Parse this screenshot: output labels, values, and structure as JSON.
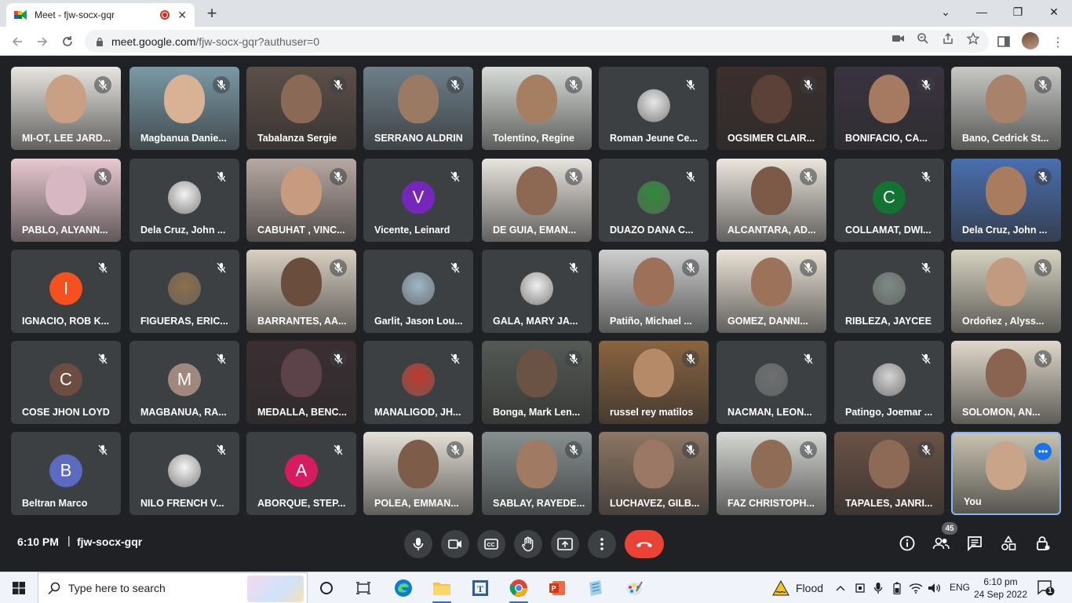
{
  "browser": {
    "tab_title": "Meet - fjw-socx-gqr",
    "tab_close": "✕",
    "new_tab": "+",
    "url_host": "meet.google.com",
    "url_path": "/fjw-socx-gqr?authuser=0",
    "window_controls": {
      "minimize": "—",
      "maximize": "❐",
      "close": "✕",
      "dropdown": "⌄"
    }
  },
  "participants": [
    {
      "name": "MI-OT, LEE JARD...",
      "kind": "video",
      "bg": "#e9e6e1",
      "skin": "#c9a083"
    },
    {
      "name": "Magbanua Danie...",
      "kind": "video",
      "bg": "#7a9aa6",
      "skin": "#d9b296"
    },
    {
      "name": "Tabalanza Sergie",
      "kind": "video",
      "bg": "#5d4f49",
      "skin": "#8a6a56"
    },
    {
      "name": "SERRANO ALDRIN",
      "kind": "video",
      "bg": "#6e7f8a",
      "skin": "#9b7a64"
    },
    {
      "name": "Tolentino, Regine",
      "kind": "video",
      "bg": "#d8dcd8",
      "skin": "#a67e62"
    },
    {
      "name": "Roman Jeune Ce...",
      "kind": "avatar",
      "avatar_color": "#e8e8e8"
    },
    {
      "name": "OGSIMER CLAIR...",
      "kind": "video",
      "bg": "#3b2f2d",
      "skin": "#5c4138"
    },
    {
      "name": "BONIFACIO, CA...",
      "kind": "video",
      "bg": "#3a3340",
      "skin": "#a67a61"
    },
    {
      "name": "Bano, Cedrick St...",
      "kind": "video",
      "bg": "#c8c8c4",
      "skin": "#a8826a"
    },
    {
      "name": "PABLO, ALYANN...",
      "kind": "video",
      "bg": "#e9c9d2",
      "skin": "#d7b7c2"
    },
    {
      "name": "Dela Cruz, John ...",
      "kind": "avatar",
      "avatar_color": "#f3f3f3"
    },
    {
      "name": "CABUHAT , VINC...",
      "kind": "video",
      "bg": "#b7a8a2",
      "skin": "#c79b7f"
    },
    {
      "name": "Vicente, Leinard",
      "kind": "initial",
      "letter": "V",
      "color": "#7627bb"
    },
    {
      "name": "DE GUIA, EMAN...",
      "kind": "video",
      "bg": "#e8e4de",
      "skin": "#8d6852"
    },
    {
      "name": "DUAZO DANA C...",
      "kind": "avatar",
      "avatar_color": "#2f8a3a"
    },
    {
      "name": "ALCANTARA, AD...",
      "kind": "video",
      "bg": "#ece6dd",
      "skin": "#7d5a47"
    },
    {
      "name": "COLLAMAT, DWI...",
      "kind": "initial",
      "letter": "C",
      "color": "#137333"
    },
    {
      "name": "Dela Cruz, John ...",
      "kind": "video",
      "bg": "#4a6fb0",
      "skin": "#a97c5f"
    },
    {
      "name": "IGNACIO, ROB K...",
      "kind": "initial",
      "letter": "I",
      "color": "#f4511e"
    },
    {
      "name": "FIGUERAS, ERIC...",
      "kind": "avatar",
      "avatar_color": "#8d6e4a"
    },
    {
      "name": "BARRANTES, AA...",
      "kind": "video",
      "bg": "#d9cfc2",
      "skin": "#6b4d3d"
    },
    {
      "name": "Garlit, Jason Lou...",
      "kind": "avatar",
      "avatar_color": "#9fb7c8"
    },
    {
      "name": "GALA, MARY JA...",
      "kind": "avatar",
      "avatar_color": "#f0eeee"
    },
    {
      "name": "Patiño, Michael ...",
      "kind": "video",
      "bg": "#cfcfcf",
      "skin": "#9c7059"
    },
    {
      "name": "GOMEZ, DANNI...",
      "kind": "video",
      "bg": "#ece4d8",
      "skin": "#9c735a"
    },
    {
      "name": "RIBLEZA, JAYCEE",
      "kind": "avatar",
      "avatar_color": "#7d8a86"
    },
    {
      "name": "Ordoñez , Alyss...",
      "kind": "video",
      "bg": "#d8d4c2",
      "skin": "#c19a80"
    },
    {
      "name": "COSE JHON LOYD",
      "kind": "initial",
      "letter": "C",
      "color": "#6d4c41"
    },
    {
      "name": "MAGBANUA, RA...",
      "kind": "initial",
      "letter": "M",
      "color": "#a1887f"
    },
    {
      "name": "MEDALLA, BENC...",
      "kind": "video",
      "bg": "#3b2e33",
      "skin": "#5b4349"
    },
    {
      "name": "MANALIGOD, JH...",
      "kind": "avatar",
      "avatar_color": "#c0392b"
    },
    {
      "name": "Bonga, Mark Len...",
      "kind": "video",
      "bg": "#555a55",
      "skin": "#6a5244"
    },
    {
      "name": "russel rey matilos",
      "kind": "video",
      "bg": "#8a6440",
      "skin": "#b48a68"
    },
    {
      "name": "NACMAN, LEON...",
      "kind": "avatar",
      "avatar_color": "#6d7071"
    },
    {
      "name": "Patingo, Joemar ...",
      "kind": "avatar",
      "avatar_color": "#d4d4d4"
    },
    {
      "name": "SOLOMON, AN...",
      "kind": "video",
      "bg": "#e0d8ca",
      "skin": "#8a6450"
    },
    {
      "name": "Beltran Marco",
      "kind": "initial",
      "letter": "B",
      "color": "#5c6bc0"
    },
    {
      "name": "NILO FRENCH V...",
      "kind": "avatar",
      "avatar_color": "#f5f5f5"
    },
    {
      "name": "ABORQUE, STEP...",
      "kind": "initial",
      "letter": "A",
      "color": "#d81b60"
    },
    {
      "name": "POLEA, EMMAN...",
      "kind": "video",
      "bg": "#e6e1d8",
      "skin": "#7e5c4a"
    },
    {
      "name": "SABLAY, RAYEDE...",
      "kind": "video",
      "bg": "#86908f",
      "skin": "#a07a62"
    },
    {
      "name": "LUCHAVEZ, GILB...",
      "kind": "video",
      "bg": "#8d7664",
      "skin": "#9b7865"
    },
    {
      "name": "FAZ CHRISTOPH...",
      "kind": "video",
      "bg": "#d7d9d4",
      "skin": "#8f6c56"
    },
    {
      "name": "TAPALES, JANRI...",
      "kind": "video",
      "bg": "#6b5246",
      "skin": "#8c6a55"
    },
    {
      "name": "You",
      "kind": "self",
      "bg": "#c8c2b0",
      "skin": "#caa489"
    }
  ],
  "meeting": {
    "time": "6:10 PM",
    "separator": "|",
    "code": "fjw-socx-gqr",
    "participant_count": "45",
    "end_call_color": "#ea4335"
  },
  "taskbar": {
    "search_placeholder": "Type here to search",
    "weather": "Flood",
    "language": "ENG",
    "time": "6:10 pm",
    "date": "24 Sep 2022",
    "notification_count": "1"
  }
}
